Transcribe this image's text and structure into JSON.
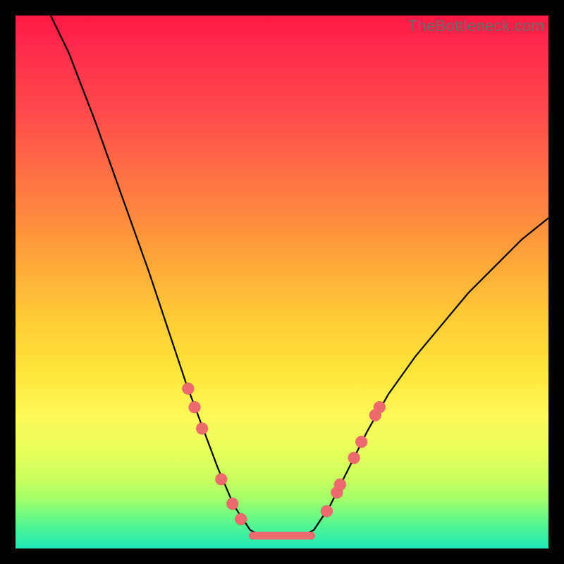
{
  "watermark": "TheBottleneck.com",
  "chart_data": {
    "type": "line",
    "title": "",
    "xlabel": "",
    "ylabel": "",
    "xlim": [
      0,
      100
    ],
    "ylim": [
      0,
      100
    ],
    "background_gradient": {
      "top": "#ff1744",
      "middle": "#ffe63a",
      "bottom": "#1de9b6"
    },
    "curve_points": [
      {
        "x": 6.6,
        "y": 100
      },
      {
        "x": 10,
        "y": 93
      },
      {
        "x": 15,
        "y": 80
      },
      {
        "x": 20,
        "y": 66
      },
      {
        "x": 25,
        "y": 52
      },
      {
        "x": 29,
        "y": 40
      },
      {
        "x": 32,
        "y": 31
      },
      {
        "x": 35,
        "y": 23
      },
      {
        "x": 38,
        "y": 15
      },
      {
        "x": 41,
        "y": 8
      },
      {
        "x": 44,
        "y": 3.5
      },
      {
        "x": 46,
        "y": 2.4
      },
      {
        "x": 50,
        "y": 2.4
      },
      {
        "x": 54,
        "y": 2.4
      },
      {
        "x": 56,
        "y": 3.5
      },
      {
        "x": 59,
        "y": 8
      },
      {
        "x": 62,
        "y": 14
      },
      {
        "x": 66,
        "y": 22
      },
      {
        "x": 70,
        "y": 29
      },
      {
        "x": 75,
        "y": 36
      },
      {
        "x": 80,
        "y": 42
      },
      {
        "x": 85,
        "y": 48
      },
      {
        "x": 90,
        "y": 53
      },
      {
        "x": 95,
        "y": 58
      },
      {
        "x": 100,
        "y": 62
      }
    ],
    "flat_bottom_segment": {
      "x0": 44.5,
      "x1": 55.5,
      "y": 2.4
    },
    "marker_points": [
      {
        "x": 32.4,
        "y": 30
      },
      {
        "x": 33.6,
        "y": 26.5
      },
      {
        "x": 35.0,
        "y": 22.5
      },
      {
        "x": 38.6,
        "y": 13
      },
      {
        "x": 40.7,
        "y": 8.4
      },
      {
        "x": 42.3,
        "y": 5.5
      },
      {
        "x": 58.4,
        "y": 7.0
      },
      {
        "x": 60.3,
        "y": 10.5
      },
      {
        "x": 60.9,
        "y": 12
      },
      {
        "x": 63.5,
        "y": 17
      },
      {
        "x": 64.9,
        "y": 20
      },
      {
        "x": 67.5,
        "y": 25
      },
      {
        "x": 68.3,
        "y": 26.5
      }
    ]
  }
}
